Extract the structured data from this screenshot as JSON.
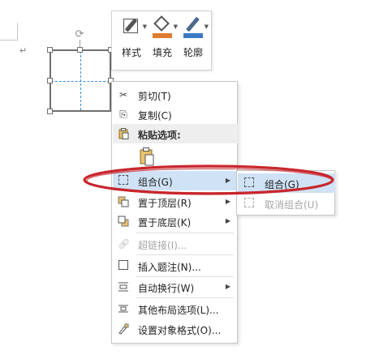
{
  "mini_toolbar": {
    "style_label": "样式",
    "fill_label": "填充",
    "outline_label": "轮廓",
    "fill_color": "#e07a2d",
    "outline_color": "#3b79c4"
  },
  "context_menu": {
    "cut": {
      "label": "剪切(T)",
      "icon": "scissors-icon"
    },
    "copy": {
      "label": "复制(C)",
      "icon": "copy-icon"
    },
    "paste_header": {
      "label": "粘贴选项:",
      "icon": "clipboard-icon"
    },
    "group": {
      "label": "组合(G)",
      "icon": "group-icon",
      "highlighted": true
    },
    "bring_front": {
      "label": "置于顶层(R)",
      "icon": "bring-to-front-icon"
    },
    "send_back": {
      "label": "置于底层(K)",
      "icon": "send-to-back-icon"
    },
    "hyperlink": {
      "label": "超链接(I)...",
      "icon": "link-icon",
      "disabled": true
    },
    "insert_caption": {
      "label": "插入题注(N)...",
      "icon": "caption-icon"
    },
    "wrap_text": {
      "label": "自动换行(W)",
      "icon": "wrap-text-icon"
    },
    "more_layout": {
      "label": "其他布局选项(L)...",
      "icon": "layout-icon"
    },
    "format_object": {
      "label": "设置对象格式(O)...",
      "icon": "format-icon"
    }
  },
  "submenu": {
    "group": {
      "label": "组合(G)",
      "icon": "group-icon",
      "highlighted": true
    },
    "ungroup": {
      "label": "取消组合(U)",
      "icon": "ungroup-icon",
      "disabled": true
    }
  },
  "annotation_color": "#c8262d",
  "highlight_color": "#cfe2f6"
}
